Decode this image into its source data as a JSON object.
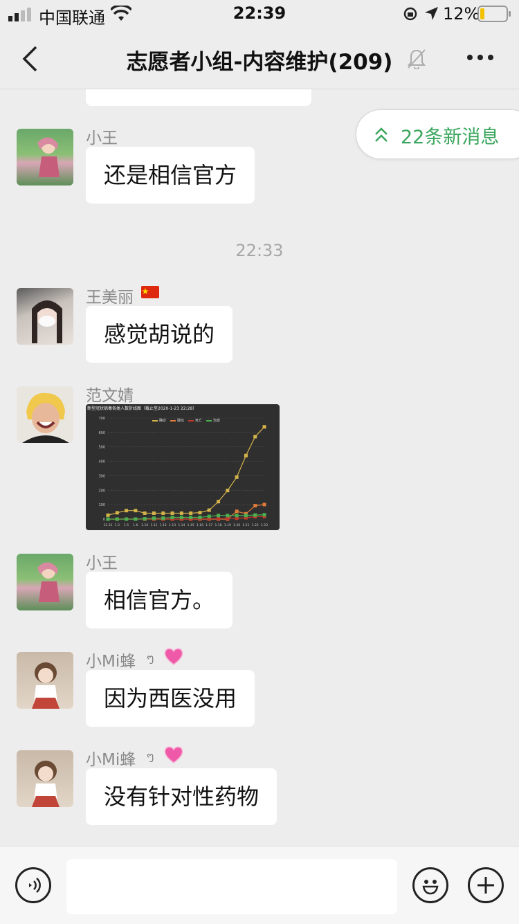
{
  "status_bar": {
    "carrier": "中国联通",
    "time": "22:39",
    "battery": "12%",
    "icons": [
      "signal-icon",
      "wifi-icon",
      "orientation-lock-icon",
      "location-icon",
      "battery-icon"
    ]
  },
  "nav": {
    "title": "志愿者小组-内容维护(209)",
    "icons": [
      "back-icon",
      "mute-bell-icon",
      "more-icon"
    ]
  },
  "new_messages": {
    "label": "22条新消息",
    "icon": "double-chevron-up-icon"
  },
  "timestamp": "22:33",
  "messages": [
    {
      "sender": "小王",
      "text": "还是相信官方"
    },
    {
      "sender": "王美丽",
      "badge": "flag-icon",
      "text": "感觉胡说的"
    },
    {
      "sender": "范文婧",
      "image": {
        "title": "新型冠状病毒各类人数折线图（截止至2020-1-23 22:28）",
        "legend": [
          "确诊",
          "疑似",
          "死亡",
          "治愈"
        ]
      }
    },
    {
      "sender": "小王",
      "text": "相信官方。"
    },
    {
      "sender": "小Mi蜂",
      "badge_text": "ᪧ",
      "badge": "heart-icon",
      "text": "因为西医没用"
    },
    {
      "sender": "小Mi蜂",
      "badge_text": "ᪧ",
      "badge": "heart-icon",
      "text": "没有针对性药物"
    }
  ],
  "chart_data": {
    "type": "line",
    "title": "新型冠状病毒各类人数折线图（截止至2020-1-23 22:28）",
    "x": [
      "12.31",
      "1.3",
      "1.5",
      "1.6",
      "1.10",
      "1.11",
      "1.12",
      "1.13",
      "1.14",
      "1.15",
      "1.16",
      "1.17",
      "1.18",
      "1.19",
      "1.20",
      "1.21",
      "1.22",
      "1.23"
    ],
    "ylim": [
      0,
      700
    ],
    "yticks": [
      0,
      100,
      200,
      300,
      400,
      500,
      600,
      700
    ],
    "series": [
      {
        "name": "确诊",
        "color": "#d4b44a",
        "values": [
          27,
          44,
          59,
          59,
          41,
          41,
          41,
          41,
          41,
          41,
          45,
          62,
          121,
          198,
          291,
          440,
          571,
          639
        ]
      },
      {
        "name": "疑似",
        "color": "#e07b39",
        "values": [
          0,
          0,
          0,
          0,
          0,
          0,
          0,
          0,
          0,
          0,
          0,
          0,
          0,
          0,
          54,
          37,
          93,
          101
        ]
      },
      {
        "name": "死亡",
        "color": "#c0392b",
        "values": [
          0,
          0,
          0,
          0,
          1,
          1,
          1,
          1,
          1,
          1,
          2,
          2,
          3,
          4,
          6,
          9,
          17,
          18
        ]
      },
      {
        "name": "治愈",
        "color": "#4caf50",
        "values": [
          0,
          0,
          0,
          0,
          2,
          6,
          7,
          12,
          12,
          12,
          12,
          19,
          25,
          25,
          25,
          25,
          28,
          30
        ]
      }
    ]
  },
  "input_bar": {
    "icons": [
      "voice-icon",
      "emoji-icon",
      "plus-icon"
    ]
  }
}
